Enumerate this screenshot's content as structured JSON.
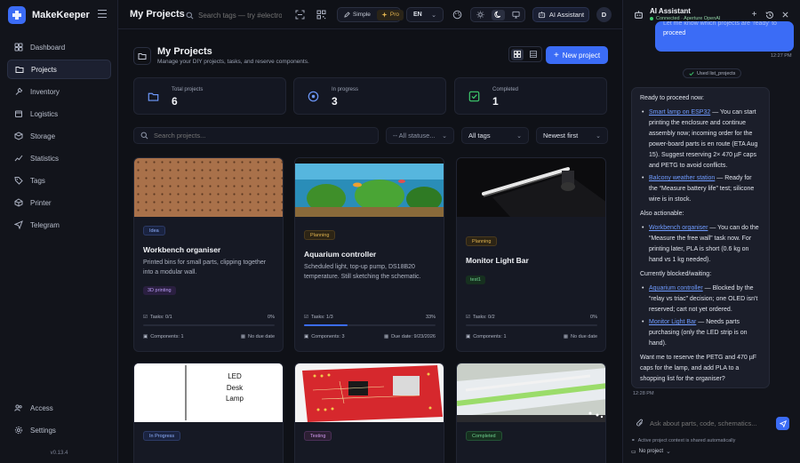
{
  "app": {
    "name": "MakeKeeper",
    "version": "v0.13.4"
  },
  "sidebar": {
    "items": [
      {
        "label": "Dashboard",
        "icon": "dashboard-icon"
      },
      {
        "label": "Projects",
        "icon": "folder-icon",
        "active": true
      },
      {
        "label": "Inventory",
        "icon": "wrench-icon"
      },
      {
        "label": "Logistics",
        "icon": "box-icon"
      },
      {
        "label": "Storage",
        "icon": "storage-icon"
      },
      {
        "label": "Statistics",
        "icon": "chart-icon"
      },
      {
        "label": "Tags",
        "icon": "tag-icon"
      },
      {
        "label": "Printer",
        "icon": "printer-icon"
      },
      {
        "label": "Telegram",
        "icon": "send-icon"
      }
    ],
    "bottom": [
      {
        "label": "Access",
        "icon": "users-icon"
      },
      {
        "label": "Settings",
        "icon": "gear-icon"
      }
    ]
  },
  "topbar": {
    "title": "My Projects",
    "search_placeholder": "Search tags — try #electron",
    "mode_simple": "Simple",
    "mode_pro": "Pro",
    "language": "EN",
    "ai_button": "AI Assistant",
    "avatar": "D"
  },
  "main": {
    "title": "My Projects",
    "subtitle": "Manage your DIY projects, tasks, and reserve components.",
    "new_project": "New project",
    "stats": [
      {
        "label": "Total projects",
        "value": "6",
        "color": "#6f9bff"
      },
      {
        "label": "In progress",
        "value": "3",
        "color": "#6f9bff"
      },
      {
        "label": "Completed",
        "value": "1",
        "color": "#3ecf6e"
      }
    ],
    "filters": {
      "search_placeholder": "Search projects...",
      "status": "-- All statuse...",
      "tags": "All tags",
      "sort": "Newest first"
    },
    "cards": [
      {
        "status": "Idea",
        "status_class": "idea",
        "title": "Workbench organiser",
        "description": "Printed bins for small parts, clipping together into a modular wall.",
        "tag": "3D printing",
        "tag_class": "purple",
        "tasks": "Tasks: 0/1",
        "percent": "0%",
        "progress": 0,
        "components": "Components: 1",
        "due": "No due date",
        "image": "pegboard"
      },
      {
        "status": "Planning",
        "status_class": "planning",
        "title": "Aquarium controller",
        "description": "Scheduled light, top-up pump, DS18B20 temperature. Still sketching the schematic.",
        "tag": "",
        "tag_class": "",
        "tasks": "Tasks: 1/3",
        "percent": "33%",
        "progress": 0.33,
        "components": "Components: 3",
        "due": "Due date: 9/23/2026",
        "image": "aquarium"
      },
      {
        "status": "Planning",
        "status_class": "planning",
        "title": "Monitor Light Bar",
        "description": "",
        "tag": "test1",
        "tag_class": "green",
        "tasks": "Tasks: 0/2",
        "percent": "0%",
        "progress": 0,
        "components": "Components: 1",
        "due": "No due date",
        "image": "lightbar"
      },
      {
        "status": "In Progress",
        "status_class": "inprogress",
        "title": "",
        "image": "led-lamp",
        "image_text": [
          "LED",
          "Desk",
          "Lamp"
        ]
      },
      {
        "status": "Testing",
        "status_class": "testing",
        "title": "",
        "image": "pcb"
      },
      {
        "status": "Completed",
        "status_class": "completed",
        "title": "",
        "image": "ledstrip"
      }
    ]
  },
  "assistant": {
    "title": "AI Assistant",
    "status": "Connected · Aperture OpenAI",
    "user_message_partial": "Let me know which projects are 'ready' to",
    "user_message_end": "proceed",
    "user_time": "12:27 PM",
    "tool_chip": "Used list_projects",
    "reply": {
      "intro": "Ready to proceed now:",
      "ready": [
        {
          "link": "Smart lamp on ESP32",
          "text": " — You can start printing the enclosure and continue assembly now; incoming order for the power-board parts is en route (ETA Aug 15). Suggest reserving 2× 470 µF caps and PETG to avoid conflicts."
        },
        {
          "link": "Balcony weather station",
          "text": " — Ready for the “Measure battery life” test; silicone wire is in stock."
        }
      ],
      "also_heading": "Also actionable:",
      "also": [
        {
          "link": "Workbench organiser",
          "text": " — You can do the “Measure the free wall” task now. For printing later, PLA is short (0.6 kg on hand vs 1 kg needed)."
        }
      ],
      "blocked_heading": "Currently blocked/waiting:",
      "blocked": [
        {
          "link": "Aquarium controller",
          "text": " — Blocked by the “relay vs triac” decision; one OLED isn't reserved; cart not yet ordered."
        },
        {
          "link": "Monitor Light Bar",
          "text": " — Needs parts purchasing (only the LED strip is on hand)."
        }
      ],
      "closing": "Want me to reserve the PETG and 470 µF caps for the lamp, and add PLA to a shopping list for the organiser?"
    },
    "reply_time": "12:28 PM",
    "composer_placeholder": "Ask about parts, code, schematics...",
    "context_note": "Active project context is shared automatically",
    "project_select": "No project"
  }
}
